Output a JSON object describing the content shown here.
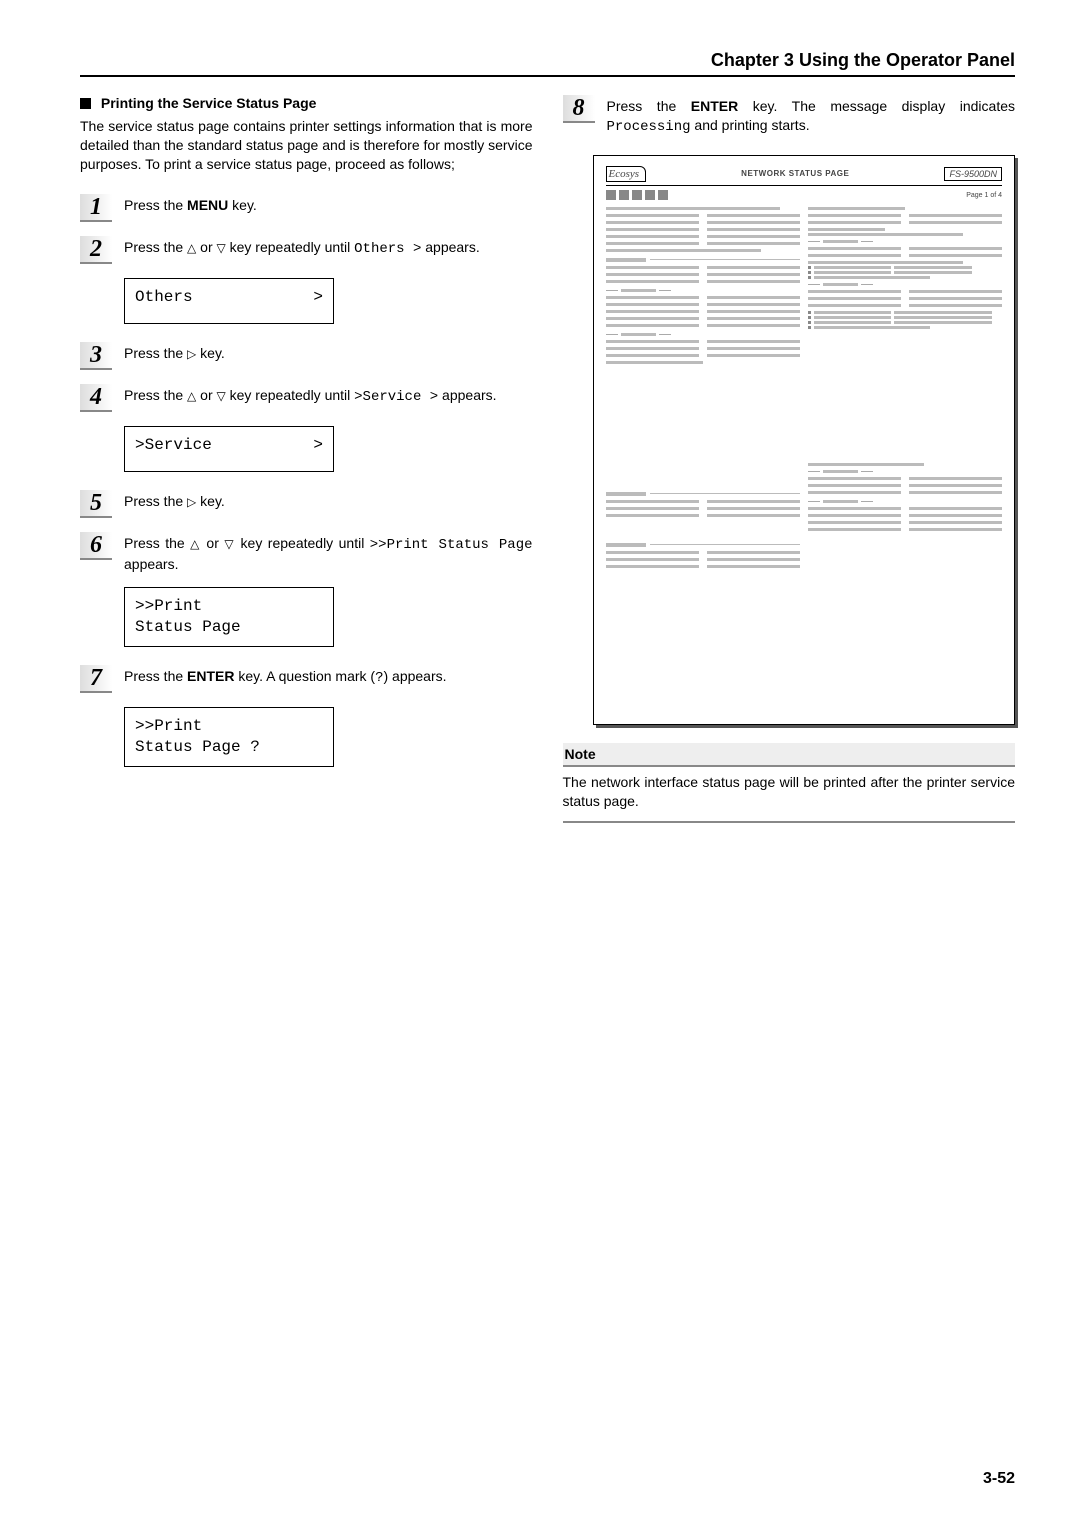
{
  "header": {
    "title": "Chapter 3  Using the Operator Panel"
  },
  "left": {
    "section_title": "Printing the Service Status Page",
    "intro": "The service status page contains printer settings information that is more detailed than the standard status page and is therefore for mostly service purposes. To print a service status page, proceed as follows;",
    "s1": {
      "num": "1",
      "pre": "Press the ",
      "key": "MENU",
      "post": " key."
    },
    "s2": {
      "num": "2",
      "pre": "Press the ",
      "mid": " key repeatedly until ",
      "code": "Others  >",
      "post": " appears."
    },
    "lcd2": {
      "l1": "Others",
      "r1": ">"
    },
    "s3": {
      "num": "3",
      "pre": "Press the ",
      "post": " key."
    },
    "s4": {
      "num": "4",
      "pre": "Press the ",
      "mid": " key repeatedly until ",
      "code": ">Service >",
      "post": " appears."
    },
    "lcd4": {
      "l1": ">Service",
      "r1": ">"
    },
    "s5": {
      "num": "5",
      "pre": "Press the ",
      "post": " key."
    },
    "s6": {
      "num": "6",
      "pre": "Press the ",
      "mid": " key repeatedly until ",
      "code": ">>Print Status Page",
      "post": " appears."
    },
    "lcd6": {
      "l1": ">>Print",
      "l2": " Status Page"
    },
    "s7": {
      "num": "7",
      "pre": "Press the ",
      "key": "ENTER",
      "mid": " key. A question mark (",
      "q": "?",
      "post": ") appears."
    },
    "lcd7": {
      "l1": ">>Print",
      "l2": " Status Page ?"
    }
  },
  "right": {
    "s8": {
      "num": "8",
      "pre": "Press the ",
      "key": "ENTER",
      "mid": " key. The message display indicates ",
      "code": "Processing",
      "post": " and printing starts."
    },
    "net": {
      "logo": "Ecosys",
      "title": "NETWORK STATUS PAGE",
      "model": "FS-9500DN",
      "pagenum": "Page 1 of 4"
    },
    "note_label": "Note",
    "note_body": "The network interface status page will be printed after the printer service status page."
  },
  "footer": {
    "page": "3-52"
  },
  "glyphs": {
    "tri_up": "△",
    "tri_down": "▽",
    "tri_right": "▷",
    "or": " or "
  }
}
